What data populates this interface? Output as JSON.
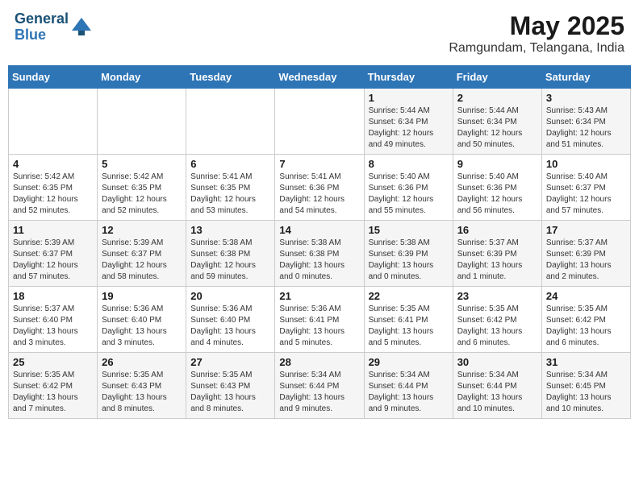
{
  "header": {
    "logo_line1": "General",
    "logo_line2": "Blue",
    "title": "May 2025",
    "subtitle": "Ramgundam, Telangana, India"
  },
  "days_of_week": [
    "Sunday",
    "Monday",
    "Tuesday",
    "Wednesday",
    "Thursday",
    "Friday",
    "Saturday"
  ],
  "weeks": [
    [
      {
        "num": "",
        "detail": ""
      },
      {
        "num": "",
        "detail": ""
      },
      {
        "num": "",
        "detail": ""
      },
      {
        "num": "",
        "detail": ""
      },
      {
        "num": "1",
        "detail": "Sunrise: 5:44 AM\nSunset: 6:34 PM\nDaylight: 12 hours\nand 49 minutes."
      },
      {
        "num": "2",
        "detail": "Sunrise: 5:44 AM\nSunset: 6:34 PM\nDaylight: 12 hours\nand 50 minutes."
      },
      {
        "num": "3",
        "detail": "Sunrise: 5:43 AM\nSunset: 6:34 PM\nDaylight: 12 hours\nand 51 minutes."
      }
    ],
    [
      {
        "num": "4",
        "detail": "Sunrise: 5:42 AM\nSunset: 6:35 PM\nDaylight: 12 hours\nand 52 minutes."
      },
      {
        "num": "5",
        "detail": "Sunrise: 5:42 AM\nSunset: 6:35 PM\nDaylight: 12 hours\nand 52 minutes."
      },
      {
        "num": "6",
        "detail": "Sunrise: 5:41 AM\nSunset: 6:35 PM\nDaylight: 12 hours\nand 53 minutes."
      },
      {
        "num": "7",
        "detail": "Sunrise: 5:41 AM\nSunset: 6:36 PM\nDaylight: 12 hours\nand 54 minutes."
      },
      {
        "num": "8",
        "detail": "Sunrise: 5:40 AM\nSunset: 6:36 PM\nDaylight: 12 hours\nand 55 minutes."
      },
      {
        "num": "9",
        "detail": "Sunrise: 5:40 AM\nSunset: 6:36 PM\nDaylight: 12 hours\nand 56 minutes."
      },
      {
        "num": "10",
        "detail": "Sunrise: 5:40 AM\nSunset: 6:37 PM\nDaylight: 12 hours\nand 57 minutes."
      }
    ],
    [
      {
        "num": "11",
        "detail": "Sunrise: 5:39 AM\nSunset: 6:37 PM\nDaylight: 12 hours\nand 57 minutes."
      },
      {
        "num": "12",
        "detail": "Sunrise: 5:39 AM\nSunset: 6:37 PM\nDaylight: 12 hours\nand 58 minutes."
      },
      {
        "num": "13",
        "detail": "Sunrise: 5:38 AM\nSunset: 6:38 PM\nDaylight: 12 hours\nand 59 minutes."
      },
      {
        "num": "14",
        "detail": "Sunrise: 5:38 AM\nSunset: 6:38 PM\nDaylight: 13 hours\nand 0 minutes."
      },
      {
        "num": "15",
        "detail": "Sunrise: 5:38 AM\nSunset: 6:39 PM\nDaylight: 13 hours\nand 0 minutes."
      },
      {
        "num": "16",
        "detail": "Sunrise: 5:37 AM\nSunset: 6:39 PM\nDaylight: 13 hours\nand 1 minute."
      },
      {
        "num": "17",
        "detail": "Sunrise: 5:37 AM\nSunset: 6:39 PM\nDaylight: 13 hours\nand 2 minutes."
      }
    ],
    [
      {
        "num": "18",
        "detail": "Sunrise: 5:37 AM\nSunset: 6:40 PM\nDaylight: 13 hours\nand 3 minutes."
      },
      {
        "num": "19",
        "detail": "Sunrise: 5:36 AM\nSunset: 6:40 PM\nDaylight: 13 hours\nand 3 minutes."
      },
      {
        "num": "20",
        "detail": "Sunrise: 5:36 AM\nSunset: 6:40 PM\nDaylight: 13 hours\nand 4 minutes."
      },
      {
        "num": "21",
        "detail": "Sunrise: 5:36 AM\nSunset: 6:41 PM\nDaylight: 13 hours\nand 5 minutes."
      },
      {
        "num": "22",
        "detail": "Sunrise: 5:35 AM\nSunset: 6:41 PM\nDaylight: 13 hours\nand 5 minutes."
      },
      {
        "num": "23",
        "detail": "Sunrise: 5:35 AM\nSunset: 6:42 PM\nDaylight: 13 hours\nand 6 minutes."
      },
      {
        "num": "24",
        "detail": "Sunrise: 5:35 AM\nSunset: 6:42 PM\nDaylight: 13 hours\nand 6 minutes."
      }
    ],
    [
      {
        "num": "25",
        "detail": "Sunrise: 5:35 AM\nSunset: 6:42 PM\nDaylight: 13 hours\nand 7 minutes."
      },
      {
        "num": "26",
        "detail": "Sunrise: 5:35 AM\nSunset: 6:43 PM\nDaylight: 13 hours\nand 8 minutes."
      },
      {
        "num": "27",
        "detail": "Sunrise: 5:35 AM\nSunset: 6:43 PM\nDaylight: 13 hours\nand 8 minutes."
      },
      {
        "num": "28",
        "detail": "Sunrise: 5:34 AM\nSunset: 6:44 PM\nDaylight: 13 hours\nand 9 minutes."
      },
      {
        "num": "29",
        "detail": "Sunrise: 5:34 AM\nSunset: 6:44 PM\nDaylight: 13 hours\nand 9 minutes."
      },
      {
        "num": "30",
        "detail": "Sunrise: 5:34 AM\nSunset: 6:44 PM\nDaylight: 13 hours\nand 10 minutes."
      },
      {
        "num": "31",
        "detail": "Sunrise: 5:34 AM\nSunset: 6:45 PM\nDaylight: 13 hours\nand 10 minutes."
      }
    ]
  ]
}
